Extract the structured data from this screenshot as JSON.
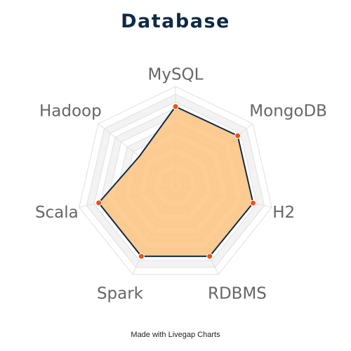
{
  "chart_data": {
    "type": "radar",
    "title": "Database",
    "categories": [
      "MySQL",
      "MongoDB",
      "H2",
      "RDBMS",
      "Spark",
      "Scala",
      "Hadoop"
    ],
    "series": [
      {
        "values": [
          102,
          103,
          103,
          102,
          102,
          102,
          60
        ]
      }
    ],
    "rlim": [
      0,
      100
    ],
    "grid": true,
    "legend": false,
    "colors": {
      "fill": "#fcc27c",
      "line": "#0e2a47",
      "marker": "#e8541c",
      "grid_fill": "#f3f3f3",
      "grid_line": "#e0e0e0",
      "label": "#666666",
      "title": "#0e2a47"
    }
  },
  "footer": {
    "credit": "Made with Livegap Charts"
  }
}
